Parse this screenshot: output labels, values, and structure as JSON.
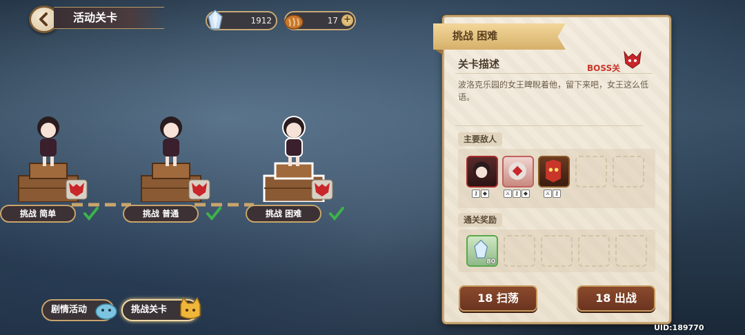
{
  "header": {
    "title": "活动关卡"
  },
  "resources": {
    "crystal": {
      "icon": "crystal-icon",
      "value": "1912"
    },
    "bread": {
      "icon": "bread-icon",
      "value": "17"
    }
  },
  "stages": [
    {
      "label": "挑战 简单",
      "completed": true
    },
    {
      "label": "挑战 普通",
      "completed": true
    },
    {
      "label": "挑战 困难",
      "completed": true,
      "selected": true
    }
  ],
  "tabs": [
    {
      "label": "剧情活动",
      "active": false
    },
    {
      "label": "挑战关卡",
      "active": true
    }
  ],
  "panel": {
    "banner": "挑战 困难",
    "desc_title": "关卡描述",
    "boss_tag": "BOSS关",
    "description": "波洛克乐园的女王睥睨着他，留下来吧，女王这么低语。",
    "enemies_title": "主要敌人",
    "rewards_title": "通关奖励",
    "reward_count": "80",
    "sweep_button": "18 扫荡",
    "fight_button": "18 出战"
  },
  "footer": {
    "uid": "UID:189770"
  },
  "colors": {
    "accent": "#c8a774",
    "button": "#7a3e26",
    "boss": "#c8362a"
  }
}
